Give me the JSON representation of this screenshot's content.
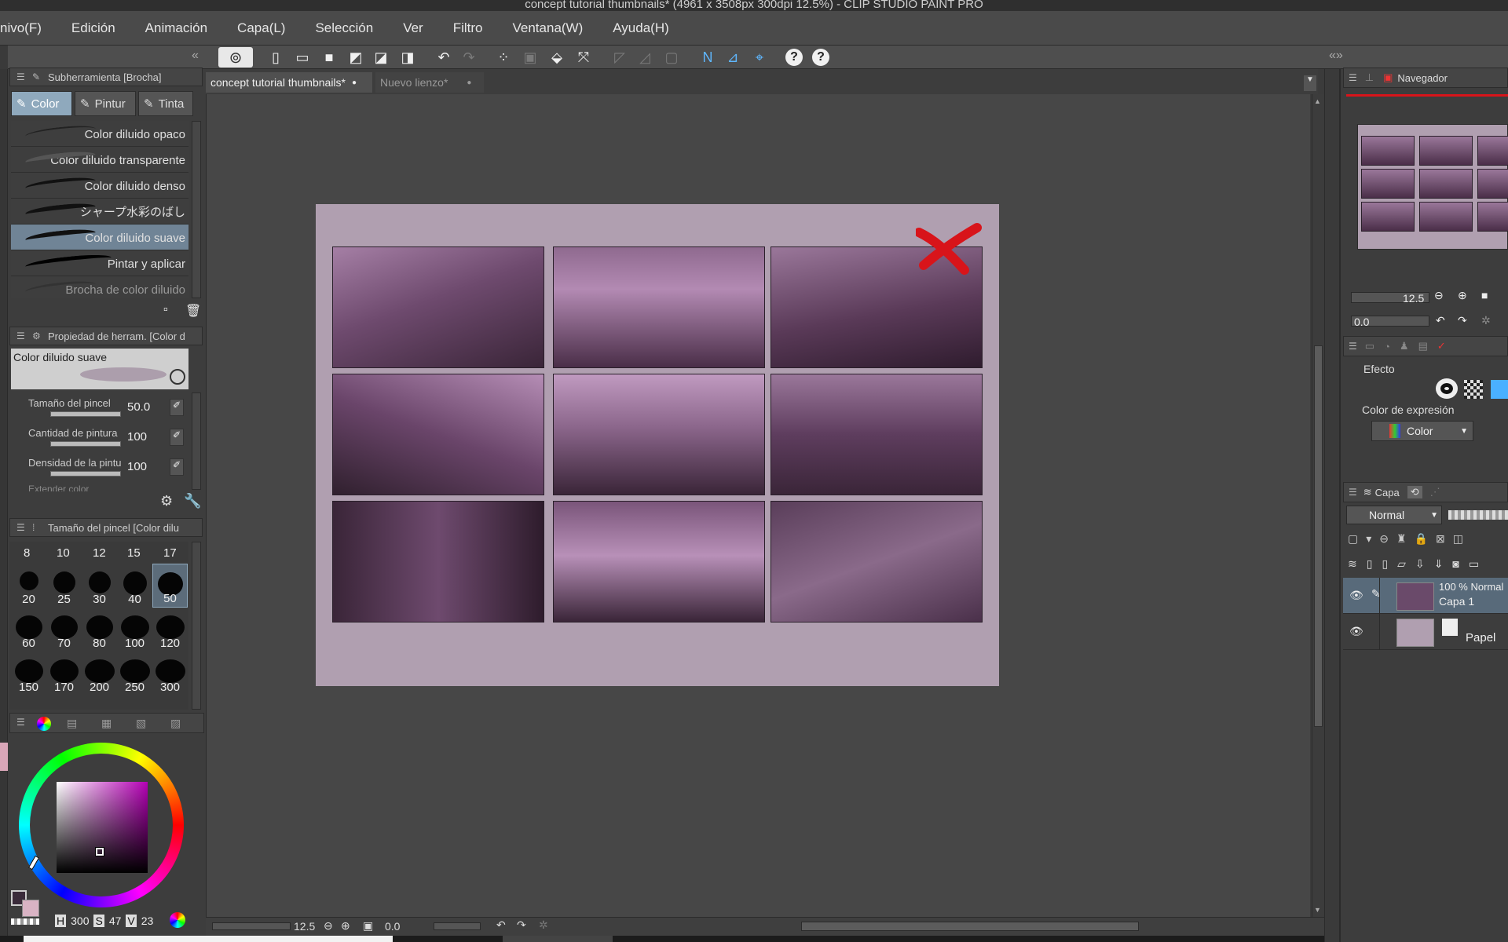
{
  "window": {
    "title": "concept tutorial thumbnails* (4961 x 3508px 300dpi 12.5%)  - CLIP STUDIO PAINT PRO"
  },
  "menu": [
    "nivo(F)",
    "Edición",
    "Animación",
    "Capa(L)",
    "Selección",
    "Ver",
    "Filtro",
    "Ventana(W)",
    "Ayuda(H)"
  ],
  "subtool_panel": {
    "title": "Subherramienta [Brocha]",
    "tabs": [
      "Color",
      "Pintur",
      "Tinta"
    ],
    "brushes": [
      "Color diluido opaco",
      "Color diluido transparente",
      "Color diluido denso",
      "シャープ水彩のばし",
      "Color diluido suave",
      "Pintar y aplicar",
      "Brocha de color diluido"
    ],
    "selected_brush": "Color diluido suave"
  },
  "tool_property": {
    "title": "Propiedad de herram. [Color d",
    "preview_name": "Color diluido suave",
    "rows": [
      {
        "label": "Tamaño del pincel",
        "value": "50.0"
      },
      {
        "label": "Cantidad de pintura",
        "value": "100"
      },
      {
        "label": "Densidad de la pintu",
        "value": "100"
      }
    ],
    "partial_row": "Extender color"
  },
  "brush_size": {
    "title": "Tamaño del pincel [Color dilu",
    "top_row": [
      "8",
      "10",
      "12",
      "15",
      "17"
    ],
    "sizes": [
      "20",
      "25",
      "30",
      "40",
      "50",
      "60",
      "70",
      "80",
      "100",
      "120",
      "150",
      "170",
      "200",
      "250",
      "300"
    ],
    "selected": "50"
  },
  "color": {
    "hsv": {
      "h_label": "H",
      "h": "300",
      "s_label": "S",
      "s": "47",
      "v_label": "V",
      "v": "23"
    },
    "hue_square": "#b400b4"
  },
  "documents": {
    "tabs": [
      {
        "label": "concept tutorial thumbnails*",
        "active": true
      },
      {
        "label": "Nuevo lienzo*",
        "active": false
      }
    ]
  },
  "canvas": {
    "paper_color": "#b09fb0",
    "zoom": "12.5",
    "rotation": "0.0"
  },
  "navigator": {
    "title": "Navegador",
    "zoom": "12.5",
    "rotation": "0.0"
  },
  "expression": {
    "effect_label": "Efecto",
    "color_expression_label": "Color de expresión",
    "color_mode": "Color"
  },
  "layers": {
    "tab_label": "Capa",
    "blend_mode": "Normal",
    "items": [
      {
        "opacity_mode": "100 % Normal",
        "name": "Capa 1"
      },
      {
        "opacity_mode": "",
        "name": "Papel"
      }
    ]
  }
}
